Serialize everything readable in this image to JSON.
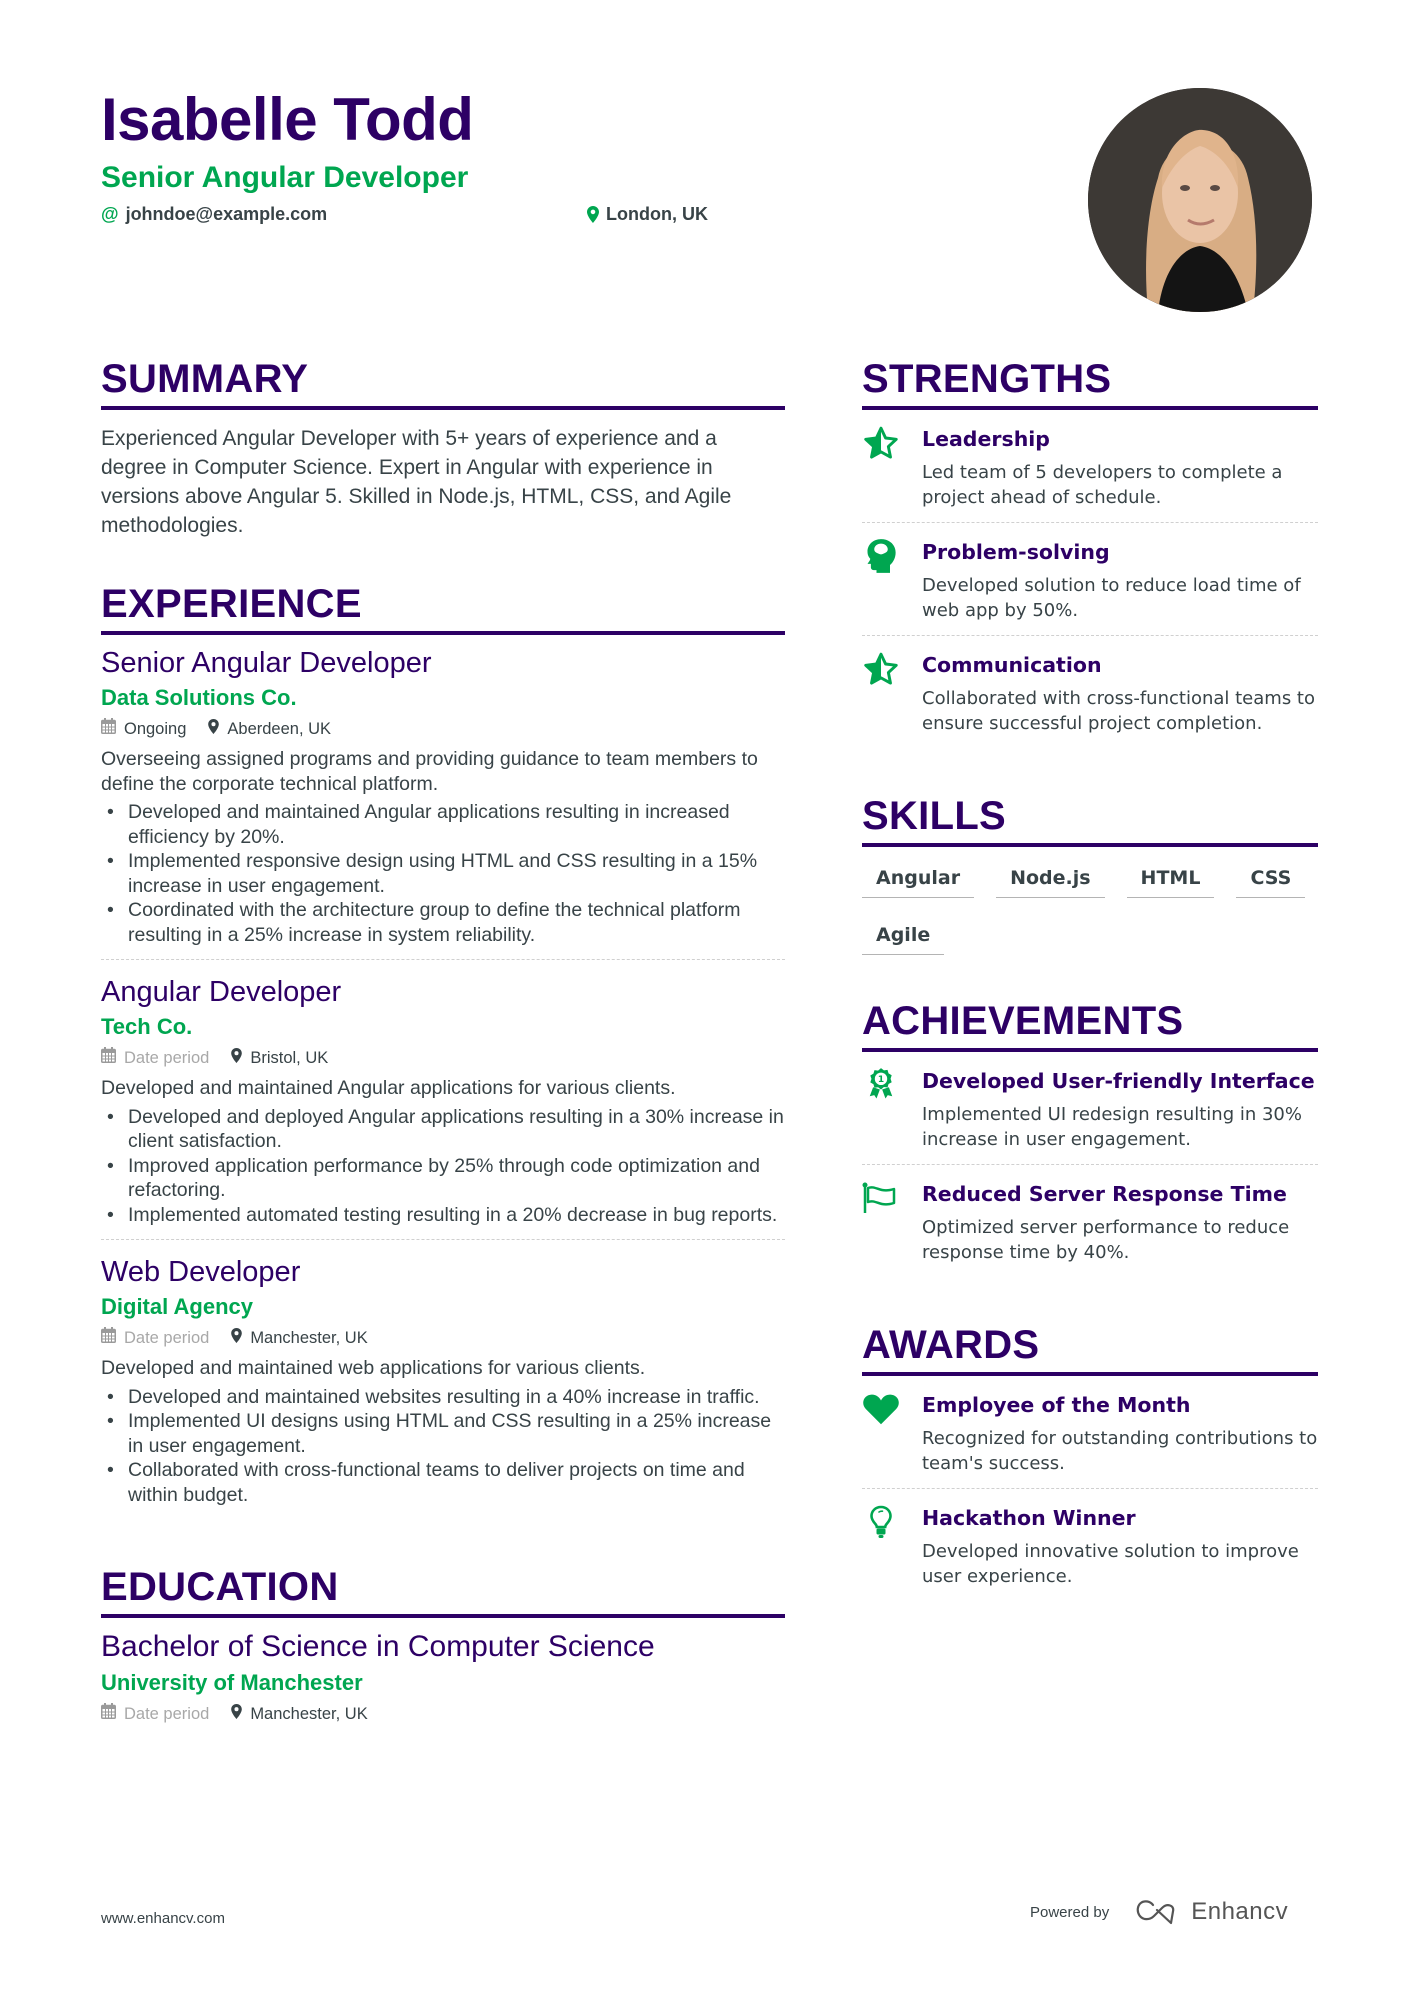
{
  "header": {
    "name": "Isabelle Todd",
    "title": "Senior Angular Developer",
    "email": "johndoe@example.com",
    "location": "London, UK",
    "email_icon": "at-icon",
    "location_icon": "map-pin-icon"
  },
  "colors": {
    "primary": "#2d0065",
    "accent": "#00a650",
    "text": "#384347"
  },
  "summary": {
    "heading": "SUMMARY",
    "text": "Experienced Angular Developer with 5+ years of experience and a degree in Computer Science. Expert in Angular with experience in versions above Angular 5. Skilled in Node.js, HTML, CSS, and Agile methodologies."
  },
  "experience": {
    "heading": "EXPERIENCE",
    "items": [
      {
        "role": "Senior Angular Developer",
        "company": "Data Solutions Co.",
        "date": "Ongoing",
        "location": "Aberdeen, UK",
        "description": "Overseeing assigned programs and providing guidance to team members to define the corporate technical platform.",
        "bullets": [
          "Developed and maintained Angular applications resulting in increased efficiency by 20%.",
          "Implemented responsive design using HTML and CSS resulting in a 15% increase in user engagement.",
          "Coordinated with the architecture group to define the technical platform resulting in a 25% increase in system reliability."
        ]
      },
      {
        "role": "Angular Developer",
        "company": "Tech Co.",
        "date": "Date period",
        "location": "Bristol, UK",
        "description": "Developed and maintained Angular applications for various clients.",
        "bullets": [
          "Developed and deployed Angular applications resulting in a 30% increase in client satisfaction.",
          "Improved application performance by 25% through code optimization and refactoring.",
          "Implemented automated testing resulting in a 20% decrease in bug reports."
        ]
      },
      {
        "role": "Web Developer",
        "company": "Digital Agency",
        "date": "Date period",
        "location": "Manchester, UK",
        "description": "Developed and maintained web applications for various clients.",
        "bullets": [
          "Developed and maintained websites resulting in a 40% increase in traffic.",
          "Implemented UI designs using HTML and CSS resulting in a 25% increase in user engagement.",
          "Collaborated with cross-functional teams to deliver projects on time and within budget."
        ]
      }
    ]
  },
  "education": {
    "heading": "EDUCATION",
    "items": [
      {
        "degree": "Bachelor of Science in Computer Science",
        "school": "University of Manchester",
        "date": "Date period",
        "location": "Manchester, UK"
      }
    ]
  },
  "strengths": {
    "heading": "STRENGTHS",
    "items": [
      {
        "icon": "half-star-icon",
        "title": "Leadership",
        "description": "Led team of 5 developers to complete a project ahead of schedule."
      },
      {
        "icon": "brain-head-icon",
        "title": "Problem-solving",
        "description": "Developed solution to reduce load time of web app by 50%."
      },
      {
        "icon": "half-star-icon",
        "title": "Communication",
        "description": "Collaborated with cross-functional teams to ensure successful project completion."
      }
    ]
  },
  "skills": {
    "heading": "SKILLS",
    "items": [
      "Angular",
      "Node.js",
      "HTML",
      "CSS",
      "Agile"
    ]
  },
  "achievements": {
    "heading": "ACHIEVEMENTS",
    "items": [
      {
        "icon": "award-ribbon-icon",
        "title": "Developed User-friendly Interface",
        "description": "Implemented UI redesign resulting in 30% increase in user engagement."
      },
      {
        "icon": "flag-icon",
        "title": "Reduced Server Response Time",
        "description": "Optimized server performance to reduce response time by 40%."
      }
    ]
  },
  "awards": {
    "heading": "AWARDS",
    "items": [
      {
        "icon": "heart-icon",
        "title": "Employee of the Month",
        "description": "Recognized for outstanding contributions to team's success."
      },
      {
        "icon": "lightbulb-icon",
        "title": "Hackathon Winner",
        "description": "Developed innovative solution to improve user experience."
      }
    ]
  },
  "footer": {
    "website": "www.enhancv.com",
    "powered_by": "Powered by",
    "brand": "Enhancv"
  }
}
